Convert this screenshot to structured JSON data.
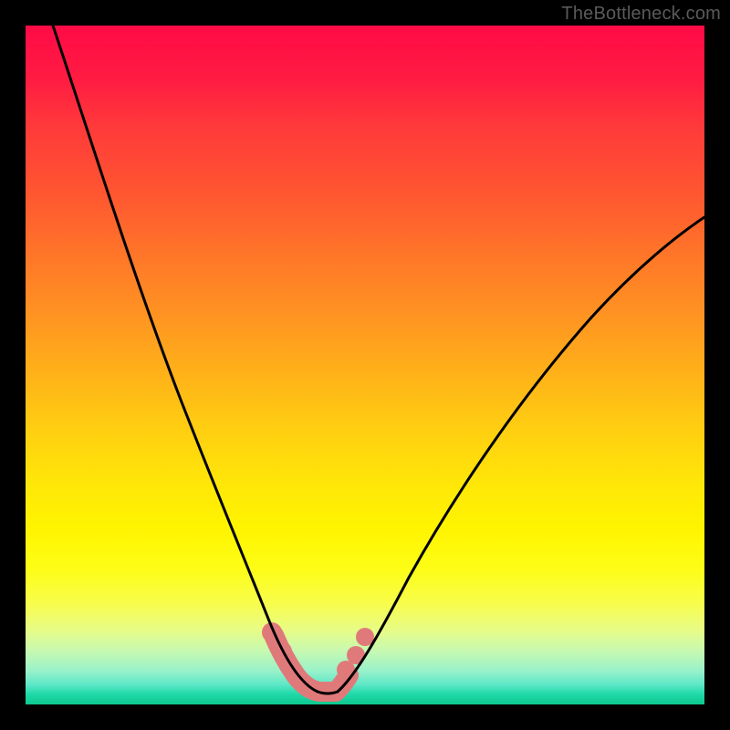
{
  "watermark": "TheBottleneck.com",
  "colors": {
    "frame": "#000000",
    "curve": "#000000",
    "highlight": "#e07a7a"
  },
  "chart_data": {
    "type": "line",
    "title": "",
    "xlabel": "",
    "ylabel": "",
    "xlim": [
      0,
      100
    ],
    "ylim": [
      0,
      100
    ],
    "grid": false,
    "series": [
      {
        "name": "left-curve",
        "x": [
          4,
          8,
          12,
          16,
          20,
          24,
          27,
          30,
          32,
          34,
          35.5,
          37,
          38.5,
          40,
          41.5,
          43
        ],
        "y": [
          100,
          89,
          78,
          67,
          56,
          45,
          36,
          27,
          21,
          15,
          11,
          8,
          5.5,
          3.5,
          2,
          1.4
        ]
      },
      {
        "name": "right-curve",
        "x": [
          46,
          48,
          50,
          52.5,
          55,
          58,
          62,
          67,
          73,
          80,
          88,
          96,
          100
        ],
        "y": [
          1.4,
          2.2,
          4,
          7,
          11,
          16,
          23,
          31,
          40,
          49,
          58,
          66,
          70
        ]
      },
      {
        "name": "bottom-flat",
        "x": [
          43,
          44.5,
          46
        ],
        "y": [
          1.4,
          1.2,
          1.4
        ]
      }
    ],
    "highlight_region": {
      "note": "salmon overlay near minimum",
      "x": [
        36,
        49
      ],
      "y_approx": [
        1.2,
        10
      ]
    },
    "highlight_beads": [
      {
        "x": 36.2,
        "y": 8.5
      },
      {
        "x": 37.6,
        "y": 5.8
      },
      {
        "x": 47.2,
        "y": 3.0
      },
      {
        "x": 48.4,
        "y": 5.2
      },
      {
        "x": 49.8,
        "y": 8.2
      }
    ]
  }
}
